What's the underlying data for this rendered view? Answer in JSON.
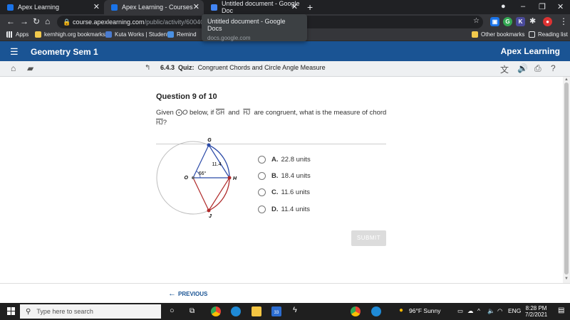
{
  "browser": {
    "tabs": [
      {
        "title": "Apex Learning",
        "color": "#1a73e8"
      },
      {
        "title": "Apex Learning - Courses",
        "color": "#1a73e8"
      },
      {
        "title": "Untitled document - Google Doc",
        "color": "#4285f4"
      }
    ],
    "url_host": "course.apexlearning.com",
    "url_path": "/public/activity/6004003...",
    "tooltip": {
      "title": "Untitled document - Google Docs",
      "domain": "docs.google.com"
    },
    "bookmarks": [
      "Apps",
      "kernhigh.org bookmarks",
      "Kuta Works | Student",
      "Remind"
    ],
    "bookmarks_right": [
      "Other bookmarks",
      "Reading list"
    ]
  },
  "apex": {
    "course_title": "Geometry Sem 1",
    "brand": "Apex Learning",
    "activity_number": "6.4.3",
    "activity_type": "Quiz:",
    "activity_title": "Congruent Chords and Circle Angle Measure"
  },
  "question": {
    "heading": "Question 9 of 10",
    "text_given": "Given",
    "circle_symbol": "⨀",
    "circle_label": "O",
    "text_below_if": "below, if",
    "chord1": "GH",
    "text_and": "and",
    "chord2": "HJ",
    "text_rest": "are congruent, what is the measure of chord",
    "chord_asked": "HJ",
    "qmark": "?"
  },
  "figure": {
    "label_g": "G",
    "label_o": "O",
    "label_h": "H",
    "label_j": "J",
    "segment_label": "11.4",
    "angle_label": "66°",
    "colors": {
      "circle": "#bdbdbd",
      "blue": "#2b4aa8",
      "red": "#b02a2a"
    }
  },
  "choices": [
    {
      "letter": "A.",
      "text": "22.8 units"
    },
    {
      "letter": "B.",
      "text": "18.4 units"
    },
    {
      "letter": "C.",
      "text": "11.6 units"
    },
    {
      "letter": "D.",
      "text": "11.4 units"
    }
  ],
  "submit_label": "SUBMIT",
  "previous_label": "PREVIOUS",
  "taskbar": {
    "search_placeholder": "Type here to search",
    "badge": "33",
    "weather": "96°F  Sunny",
    "lang": "ENG",
    "time": "8:28 PM",
    "date": "7/2/2021"
  }
}
